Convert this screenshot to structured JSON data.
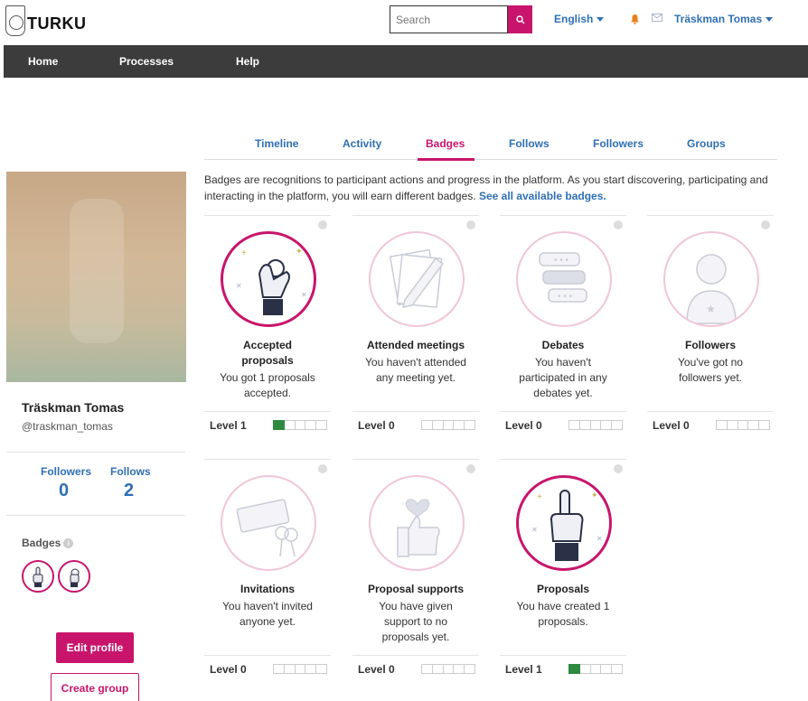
{
  "header": {
    "logo_text": "TURKU",
    "search_placeholder": "Search",
    "language": "English",
    "user_menu": "Träskman Tomas"
  },
  "nav": {
    "items": [
      "Home",
      "Processes",
      "Help"
    ]
  },
  "profile": {
    "name": "Träskman Tomas",
    "nickname": "@traskman_tomas",
    "followers_label": "Followers",
    "followers_count": "0",
    "follows_label": "Follows",
    "follows_count": "2",
    "badges_label": "Badges",
    "edit_button": "Edit profile",
    "create_group_button": "Create group"
  },
  "tabs": [
    "Timeline",
    "Activity",
    "Badges",
    "Follows",
    "Followers",
    "Groups"
  ],
  "active_tab": "Badges",
  "intro": {
    "text": "Badges are recognitions to participant actions and progress in the platform. As you start discovering, participating and interacting in the platform, you will earn different badges.",
    "link": "See all available badges."
  },
  "badges": [
    {
      "title": "Accepted proposals",
      "desc": "You got 1 proposals accepted.",
      "level_label": "Level 1",
      "level": 1,
      "earned": true,
      "icon": "ok-hand-icon"
    },
    {
      "title": "Attended meetings",
      "desc": "You haven't attended any meeting yet.",
      "level_label": "Level 0",
      "level": 0,
      "earned": false,
      "icon": "pencil-paper-icon"
    },
    {
      "title": "Debates",
      "desc": "You haven't participated in any debates yet.",
      "level_label": "Level 0",
      "level": 0,
      "earned": false,
      "icon": "chat-bubbles-icon"
    },
    {
      "title": "Followers",
      "desc": "You've got no followers yet.",
      "level_label": "Level 0",
      "level": 0,
      "earned": false,
      "icon": "person-icon"
    },
    {
      "title": "Invitations",
      "desc": "You haven't invited anyone yet.",
      "level_label": "Level 0",
      "level": 0,
      "earned": false,
      "icon": "ticket-keys-icon"
    },
    {
      "title": "Proposal supports",
      "desc": "You have given support to no proposals yet.",
      "level_label": "Level 0",
      "level": 0,
      "earned": false,
      "icon": "thumbs-up-heart-icon"
    },
    {
      "title": "Proposals",
      "desc": "You have created 1 proposals.",
      "level_label": "Level 1",
      "level": 1,
      "earned": true,
      "icon": "raised-finger-icon"
    }
  ],
  "colors": {
    "brand": "#c8156b",
    "link": "#2f6fb5",
    "nav_bg": "#3c3c3c",
    "level_on": "#2d8a3e"
  }
}
